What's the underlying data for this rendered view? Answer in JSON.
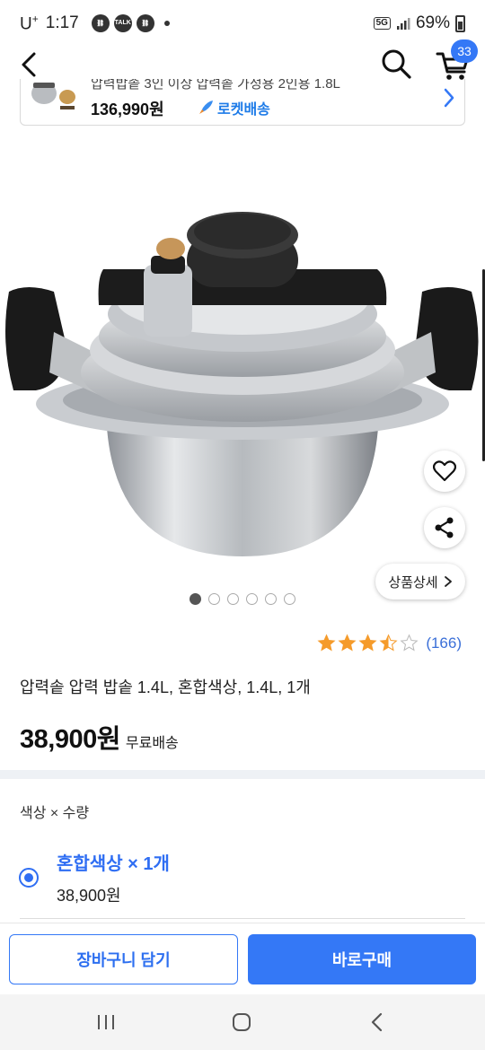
{
  "status_bar": {
    "carrier": "U",
    "carrier_sup": "+",
    "time": "1:17",
    "network_badge": "5G",
    "battery": "69%",
    "icons": [
      "link-icon",
      "talk-icon",
      "link-icon"
    ]
  },
  "header": {
    "cart_count": "33",
    "icons": [
      "back-icon",
      "search-icon",
      "cart-icon"
    ]
  },
  "related_product": {
    "title": "압력밥솥 3인 이상 압력솥 가정용 2인용 1.8L",
    "price": "136,990원",
    "delivery": "로켓배송"
  },
  "gallery": {
    "total_images": 6,
    "current_index": 0,
    "detail_button": "상품상세"
  },
  "rating": {
    "stars": 3.5,
    "max_stars": 5,
    "review_count": "(166)"
  },
  "product": {
    "title": "압력솥 압력 밥솥 1.4L, 혼합색상, 1.4L, 1개",
    "price": "38,900원",
    "shipping": "무료배송"
  },
  "options": {
    "label": "색상 × 수량",
    "selected_name": "혼합색상 × 1개",
    "selected_price": "38,900원"
  },
  "actions": {
    "add_to_cart": "장바구니 담기",
    "buy_now": "바로구매"
  },
  "colors": {
    "accent": "#3478f6",
    "rocket": "#1d7be8",
    "star": "#f59b2b"
  }
}
